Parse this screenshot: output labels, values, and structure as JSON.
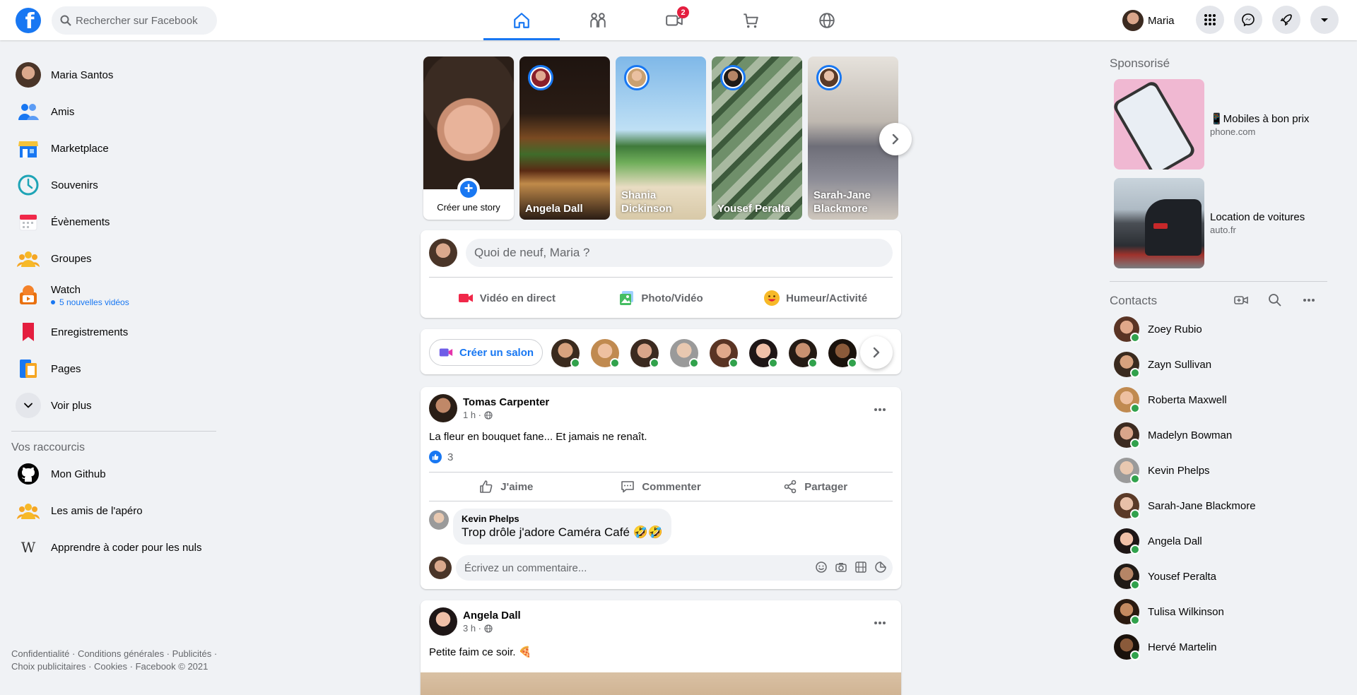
{
  "topbar": {
    "search_placeholder": "Rechercher sur Facebook",
    "video_badge": "2",
    "profile_name": "Maria"
  },
  "left": {
    "items": [
      {
        "label": "Maria Santos"
      },
      {
        "label": "Amis"
      },
      {
        "label": "Marketplace"
      },
      {
        "label": "Souvenirs"
      },
      {
        "label": "Évènements"
      },
      {
        "label": "Groupes"
      },
      {
        "label": "Watch",
        "sub": "5 nouvelles vidéos"
      },
      {
        "label": "Enregistrements"
      },
      {
        "label": "Pages"
      },
      {
        "label": "Voir plus"
      }
    ],
    "shortcuts_title": "Vos raccourcis",
    "shortcuts": [
      {
        "label": "Mon Github"
      },
      {
        "label": "Les amis de l'apéro"
      },
      {
        "label": "Apprendre à coder pour les nuls"
      }
    ],
    "footer": "Confidentialité · Conditions générales · Publicités · Choix publicitaires · Cookies · Facebook © 2021"
  },
  "stories": {
    "create_label": "Créer une story",
    "items": [
      {
        "name": "Angela Dall"
      },
      {
        "name": "Shania Dickinson"
      },
      {
        "name": "Yousef Peralta"
      },
      {
        "name": "Sarah-Jane Blackmore"
      }
    ]
  },
  "composer": {
    "placeholder": "Quoi de neuf, Maria ?",
    "live": "Vidéo en direct",
    "photo": "Photo/Vidéo",
    "feeling": "Humeur/Activité"
  },
  "rooms": {
    "create_label": "Créer un salon"
  },
  "post1": {
    "author": "Tomas Carpenter",
    "time": "1 h ·",
    "text": "La fleur en bouquet fane... Et jamais ne renaît.",
    "likes": "3",
    "like_label": "J'aime",
    "comment_label": "Commenter",
    "share_label": "Partager",
    "comment_author": "Kevin Phelps",
    "comment_text": "Trop drôle j'adore Caméra Café 🤣🤣",
    "write_placeholder": "Écrivez un commentaire..."
  },
  "post2": {
    "author": "Angela Dall",
    "time": "3 h ·",
    "text": "Petite faim ce soir. 🍕"
  },
  "right": {
    "sponsored_title": "Sponsorisé",
    "ads": [
      {
        "title": "📱Mobiles à bon prix",
        "url": "phone.com"
      },
      {
        "title": "Location de voitures",
        "url": "auto.fr"
      }
    ],
    "contacts_title": "Contacts",
    "contacts": [
      {
        "name": "Zoey Rubio"
      },
      {
        "name": "Zayn Sullivan"
      },
      {
        "name": "Roberta Maxwell"
      },
      {
        "name": "Madelyn Bowman"
      },
      {
        "name": "Kevin Phelps"
      },
      {
        "name": "Sarah-Jane Blackmore"
      },
      {
        "name": "Angela Dall"
      },
      {
        "name": "Yousef Peralta"
      },
      {
        "name": "Tulisa Wilkinson"
      },
      {
        "name": "Hervé Martelin"
      }
    ]
  },
  "colors": {
    "brand": "#1877f2",
    "online": "#31a24c",
    "badge": "#e41e3f"
  }
}
